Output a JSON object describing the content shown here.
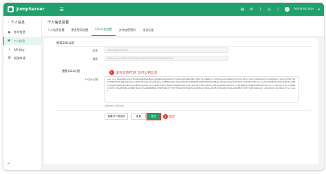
{
  "header": {
    "brand": "JumpServer",
    "menu_icon": "hamburger-icon",
    "icons": [
      "ticket-icon",
      "message-icon",
      "help-icon",
      "language-icon",
      "bell-icon"
    ],
    "username": "Administrator",
    "brand_color": "#20a06c"
  },
  "sidebar": {
    "title": "个人信息",
    "items": [
      {
        "label": "账号信息",
        "icon": "user-icon",
        "active": false
      },
      {
        "label": "个人信息",
        "icon": "profile-icon",
        "active": true
      },
      {
        "label": "API Key",
        "icon": "key-icon",
        "active": false
      },
      {
        "label": "权限申请",
        "icon": "apply-icon",
        "active": false
      }
    ],
    "collapse_icon": "collapse-icon"
  },
  "page": {
    "title": "个人信息设置",
    "tabs": [
      {
        "label": "个人信息设置",
        "active": false
      },
      {
        "label": "更多密码设置",
        "active": false
      },
      {
        "label": "SSH公钥设置",
        "active": true
      },
      {
        "label": "文件加密密码",
        "active": false
      },
      {
        "label": "活动记录",
        "active": false
      }
    ]
  },
  "form": {
    "old_section_title": "原来SSH公钥",
    "name_label": "名称",
    "name_value": "admin@jumpserver",
    "fingerprint_label": "指纹",
    "fingerprint_value": "MD5:de:1e:e5:80:c5:71:7e:f9:c6:35:59:4f:1f:5f:af:2d:d0:f2:bd",
    "new_section_title": "更新SSH公钥",
    "pubkey_label": "* SSH公钥",
    "pubkey_value": "ssh-rsa AAAAB3NzaC1yc2EAAAADAQABAAABgQCvHeKBDJaKVTwkhB7yYXehaeLKDLmWkHHMk/dKN/Vv/mHWNF+LcuYNdYdxsyGsrW8ZUj7QsTloiYNfcItJzQrS3a4Bg+QTcbu3SOO4bIJrz1hzZtVHnF7SMHTT8MIFKCTM4W6nXHpJqbvnAtW9rHS9SjK+7KvSF6iBe+/tdMMWtb9IWrTmQzCMIaCBfJ4IMHPZ6xMjN9YPO4f66hWBwQjiR5qnPgsWgFv3FXh1fIvThP7NFJfb8i7gjCjwHVj0yEQBYbx1WYd7h4RFCFz4RQ2EySpWk3gGUHs4uxNDnEoxPeBoKnaJp5MkL4lnUJsBDnhYBMjzE8mkU7wQpRnKsbpFAg9jJR3LwRtl8GtTGZk0qx5P8JqnoqMHtnUNJ0uCrXfOmJeWDBvqX9ND6wnDEk4B1YZhsXc3ijTHLQuwYCxG7JiKRWkx9c9YzLr8LgB3HsNpyEq0NDr6oUXcCVwe8RWE8B2AiYQGVtmNvXP3r5J8fV1zWgT6fD2eMn3qA1kB9Lp7xHcUo+R5tEz6nYaw0KjdSm4LvQ8uBZxPr2hTIfyKAl0dgCe9= admin@cmi-MacBook-Pro.local",
    "pubkey_hint": "复制你的公钥到这里",
    "btn_reset": "重置并下载密钥",
    "btn_cancel": "重置",
    "btn_submit": "提交"
  },
  "annotations": {
    "step1_num": "1",
    "step1_text": "填写本地PC的 SSH公钥信息",
    "step2_num": "2",
    "step2_text": "提交",
    "color": "#e53935"
  }
}
